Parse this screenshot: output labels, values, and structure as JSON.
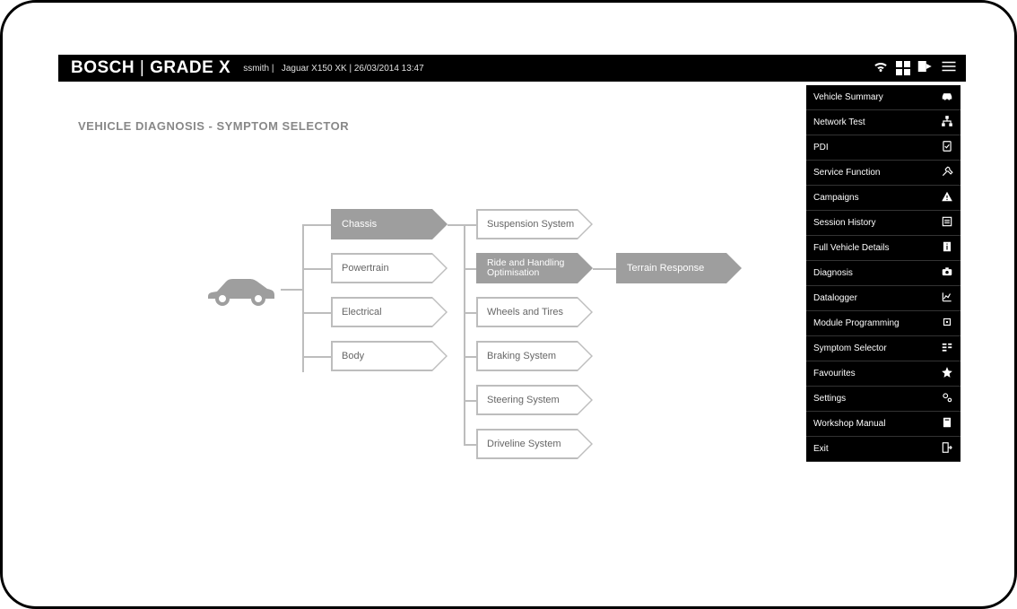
{
  "header": {
    "brand_left": "BOSCH",
    "brand_right": "GRADE X",
    "user": "ssmith",
    "vehicle": "Jaguar X150 XK",
    "datetime": "26/03/2014 13:47"
  },
  "page_title": "VEHICLE DIAGNOSIS - SYMPTOM SELECTOR",
  "level1": [
    {
      "label": "Chassis",
      "selected": true
    },
    {
      "label": "Powertrain",
      "selected": false
    },
    {
      "label": "Electrical",
      "selected": false
    },
    {
      "label": "Body",
      "selected": false
    }
  ],
  "level2": [
    {
      "label": "Suspension System",
      "selected": false
    },
    {
      "label": "Ride and Handling Optimisation",
      "selected": true
    },
    {
      "label": "Wheels and Tires",
      "selected": false
    },
    {
      "label": "Braking System",
      "selected": false
    },
    {
      "label": "Steering System",
      "selected": false
    },
    {
      "label": "Driveline System",
      "selected": false
    }
  ],
  "level3": [
    {
      "label": "Terrain Response",
      "selected": true
    }
  ],
  "sidebar": [
    {
      "label": "Vehicle Summary",
      "icon": "car"
    },
    {
      "label": "Network Test",
      "icon": "network"
    },
    {
      "label": "PDI",
      "icon": "clipboard-check"
    },
    {
      "label": "Service Function",
      "icon": "tools"
    },
    {
      "label": "Campaigns",
      "icon": "warning"
    },
    {
      "label": "Session History",
      "icon": "list"
    },
    {
      "label": "Full Vehicle Details",
      "icon": "info"
    },
    {
      "label": "Diagnosis",
      "icon": "camera"
    },
    {
      "label": "Datalogger",
      "icon": "chart"
    },
    {
      "label": "Module Programming",
      "icon": "chip"
    },
    {
      "label": "Symptom Selector",
      "icon": "selector"
    },
    {
      "label": "Favourites",
      "icon": "star"
    },
    {
      "label": "Settings",
      "icon": "gears"
    },
    {
      "label": "Workshop Manual",
      "icon": "book"
    },
    {
      "label": "Exit",
      "icon": "exit"
    }
  ]
}
